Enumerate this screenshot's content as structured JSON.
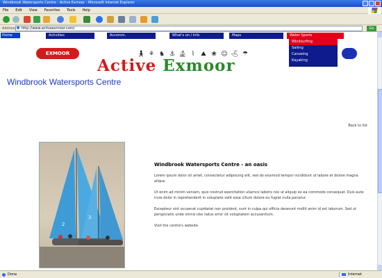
{
  "window": {
    "title": "Windbrook Watersports Centre - Active Exmoor - Microsoft Internet Explorer"
  },
  "menubar": {
    "items": [
      "File",
      "Edit",
      "View",
      "Favorites",
      "Tools",
      "Help"
    ]
  },
  "addressbar": {
    "label": "Address",
    "url": "http://www.activeexmoor.com/",
    "go_label": "Go"
  },
  "nav": {
    "home_label": "Home",
    "tabs": [
      "Activities",
      "Accomm.",
      "What's on / Info",
      "Maps"
    ],
    "dropdown_label": "Water Sports",
    "dropdown_items": [
      "Windsurfing",
      "Sailing",
      "Canoeing",
      "Kayaking"
    ],
    "dropdown_active_index": 0
  },
  "logo": {
    "left_pill_text": "EXMOOR",
    "word1": "Active",
    "word2": "Exmoor",
    "icons": [
      "hiker-icon",
      "cyclist-icon",
      "horse-rider-icon",
      "angler-icon",
      "sailboat-icon",
      "canoe-icon",
      "climber-icon",
      "bird-icon",
      "runner-icon",
      "golfer-icon",
      "paraglider-icon"
    ]
  },
  "page": {
    "title": "Windbrook Watersports Centre",
    "date": "Back to list",
    "article": {
      "heading": "Windbrook Watersports Centre - an oasis",
      "paragraphs": [
        "Lorem ipsum dolor sit amet, consectetur adipiscing elit, sed do eiusmod tempor incididunt ut labore et dolore magna aliqua.",
        "Ut enim ad minim veniam, quis nostrud exercitation ullamco laboris nisi ut aliquip ex ea commodo consequat. Duis aute irure dolor in reprehenderit in voluptate velit esse cillum dolore eu fugiat nulla pariatur.",
        "Excepteur sint occaecat cupidatat non proident, sunt in culpa qui officia deserunt mollit anim id est laborum. Sed ut perspiciatis unde omnis iste natus error sit voluptatem accusantium.",
        "Visit the centre's website"
      ]
    }
  },
  "statusbar": {
    "text": "Done",
    "zone": "Internet"
  },
  "colors": {
    "nav_tab": "#0e1b8c",
    "nav_active": "#e2001a",
    "title_blue": "#1a37c8",
    "logo_red": "#d21b1b",
    "logo_green": "#2a8a2a"
  }
}
